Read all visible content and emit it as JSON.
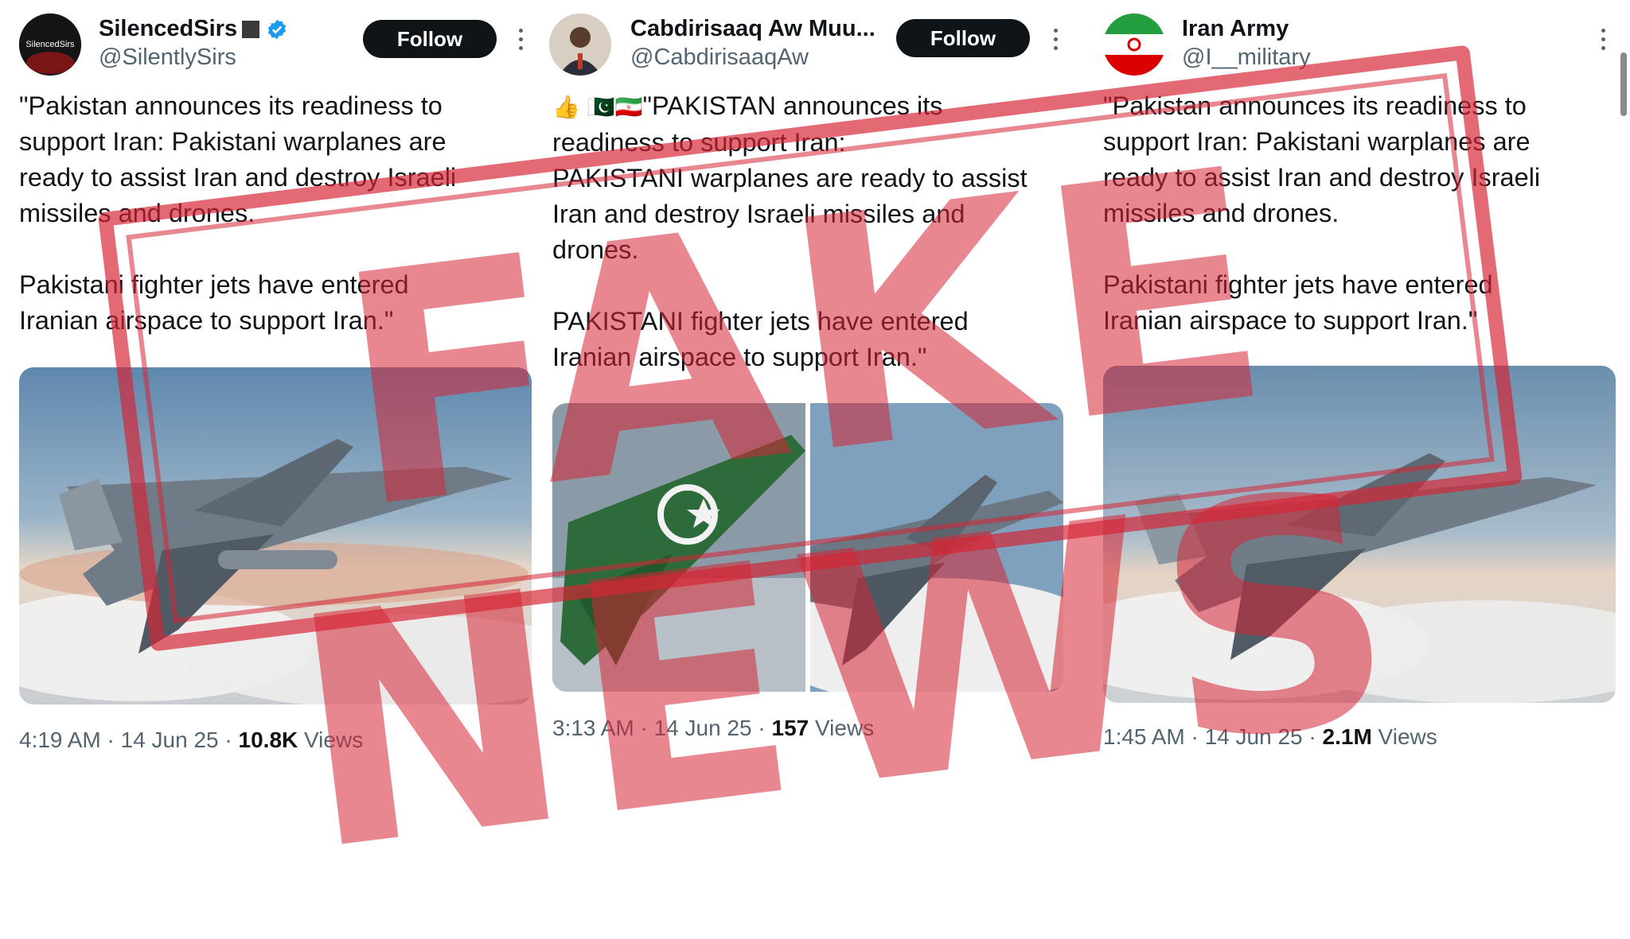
{
  "posts": [
    {
      "display_name": "SilencedSirs",
      "handle": "@SilentlySirs",
      "avatar_text": "SilencedSirs",
      "follow_label": "Follow",
      "verified": true,
      "text": "\"Pakistan announces its readiness to\nsupport Iran: Pakistani warplanes are\nready to assist Iran and destroy Israeli\nmissiles and drones.\n\nPakistani fighter jets have entered\nIranian airspace to support Iran.\"",
      "time": "4:19 AM",
      "date": "14 Jun 25",
      "views_count": "10.8K",
      "views_label": "Views"
    },
    {
      "display_name": "Cabdirisaaq Aw Muu...",
      "handle": "@CabdirisaaqAw",
      "follow_label": "Follow",
      "emoji": "👍 🇵🇰🇮🇷",
      "text": "\"PAKISTAN announces its\nreadiness to support Iran:\nPAKISTANI warplanes are ready to assist\nIran and destroy Israeli missiles and\ndrones.\n\nPAKISTANI fighter jets have entered\nIranian airspace to support Iran.\"",
      "time": "3:13 AM",
      "date": "14 Jun 25",
      "views_count": "157",
      "views_label": "Views"
    },
    {
      "display_name": "Iran Army",
      "handle": "@I__military",
      "text": "\"Pakistan announces its readiness to\nsupport Iran: Pakistani warplanes are\nready to assist Iran and destroy Israeli\nmissiles and drones.\n\nPakistani fighter jets have entered\nIranian airspace to support Iran.\"",
      "time": "1:45 AM",
      "date": "14 Jun 25",
      "views_count": "2.1M",
      "views_label": "Views"
    }
  ],
  "overlay": {
    "stamp_text": "FAKE NEWS"
  },
  "colors": {
    "stamp": "#d62434",
    "follow_bg": "#0f1419",
    "verified": "#1d9bf0",
    "muted": "#536471"
  },
  "icons": [
    "verified-badge-icon",
    "more-options-icon",
    "pakistan-flag-icon",
    "iran-flag-icon"
  ]
}
